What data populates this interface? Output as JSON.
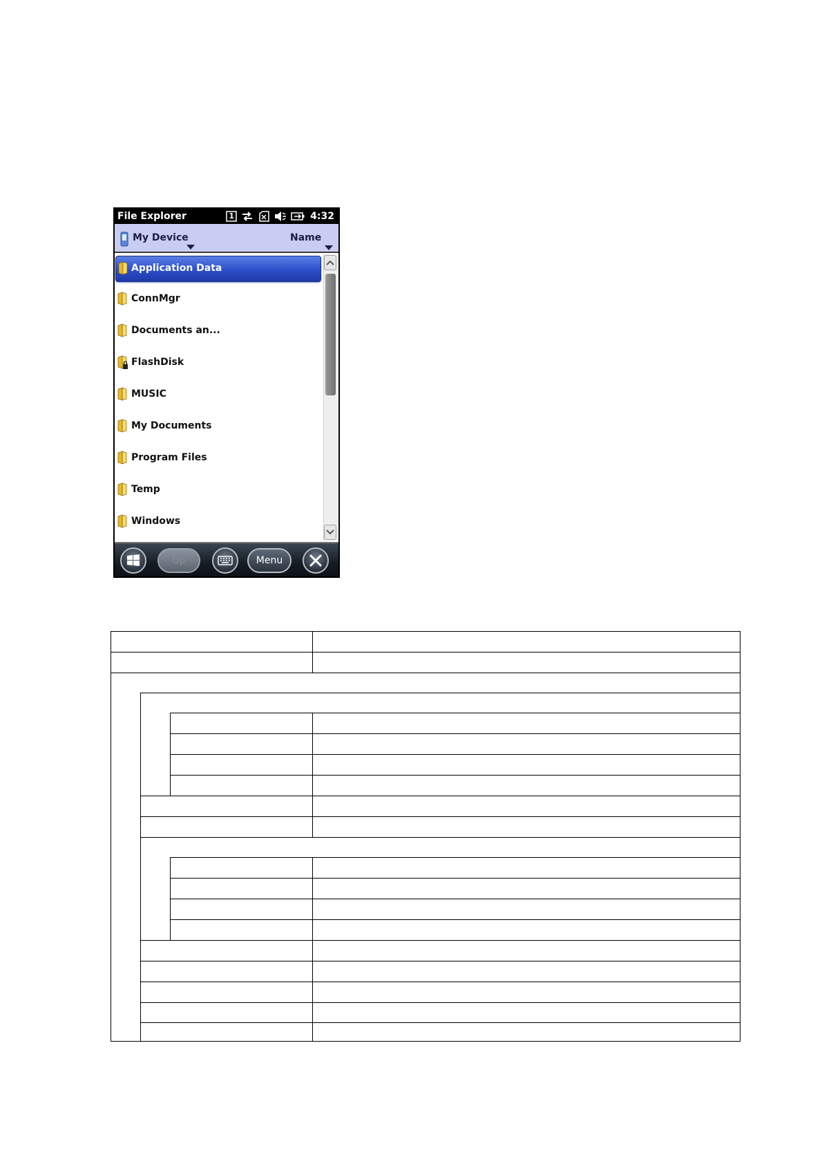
{
  "window": {
    "title": "File Explorer",
    "clock": "4:32",
    "slot_number": "1"
  },
  "icons": {
    "status": [
      "notification-number-icon",
      "connectivity-arrows-icon",
      "no-signal-icon",
      "speaker-muted-icon",
      "battery-icon"
    ],
    "location": "device-icon",
    "folder": "folder-icon",
    "start": "windows-start-icon",
    "keyboard": "keyboard-icon",
    "close": "close-icon"
  },
  "header": {
    "location": "My Device",
    "sort_label": "Name"
  },
  "files": [
    {
      "name": "Application Data",
      "selected": true
    },
    {
      "name": "ConnMgr"
    },
    {
      "name": "Documents an..."
    },
    {
      "name": "FlashDisk",
      "locked": true
    },
    {
      "name": "MUSIC"
    },
    {
      "name": "My Documents"
    },
    {
      "name": "Program Files"
    },
    {
      "name": "Temp"
    },
    {
      "name": "Windows"
    }
  ],
  "taskbar": {
    "up_label": "Up",
    "menu_label": "Menu"
  },
  "colors": {
    "selection": "#2d4ec9",
    "header": "#c9cdf1",
    "statusbar": "#000000"
  }
}
